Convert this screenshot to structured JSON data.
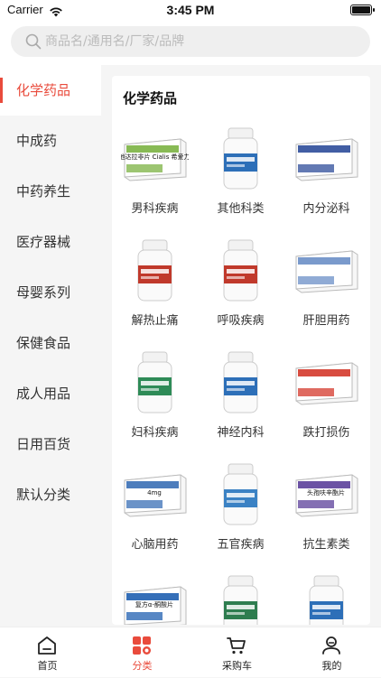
{
  "status": {
    "carrier": "Carrier",
    "time": "3:45 PM"
  },
  "search": {
    "placeholder": "商品名/通用名/厂家/品牌"
  },
  "sidebar": {
    "items": [
      {
        "label": "化学药品",
        "active": true
      },
      {
        "label": "中成药"
      },
      {
        "label": "中药养生"
      },
      {
        "label": "医疗器械"
      },
      {
        "label": "母婴系列"
      },
      {
        "label": "保健食品"
      },
      {
        "label": "成人用品"
      },
      {
        "label": "日用百货"
      },
      {
        "label": "默认分类"
      }
    ]
  },
  "section_title": "化学药品",
  "products": [
    {
      "label": "男科疾病",
      "pack_text": "他达拉非片 Cialis 希爱力",
      "color": "#7bb242"
    },
    {
      "label": "其他科类",
      "pack_text": "",
      "color": "#2d6fb8"
    },
    {
      "label": "内分泌科",
      "pack_text": "",
      "color": "#2d4c9a"
    },
    {
      "label": "解热止痛",
      "pack_text": "",
      "color": "#c0392b"
    },
    {
      "label": "呼吸疾病",
      "pack_text": "",
      "color": "#c0392b"
    },
    {
      "label": "肝胆用药",
      "pack_text": "",
      "color": "#6b8fc7"
    },
    {
      "label": "妇科疾病",
      "pack_text": "",
      "color": "#2e8b57"
    },
    {
      "label": "神经内科",
      "pack_text": "",
      "color": "#2d6fb8"
    },
    {
      "label": "跌打损伤",
      "pack_text": "",
      "color": "#d4382b"
    },
    {
      "label": "心脑用药",
      "pack_text": "4mg",
      "color": "#3a6fb5"
    },
    {
      "label": "五官疾病",
      "pack_text": "",
      "color": "#3b82c4"
    },
    {
      "label": "抗生素类",
      "pack_text": "头孢呋辛酯片",
      "color": "#5b3f9a"
    },
    {
      "label": "",
      "pack_text": "复方α-酮酸片",
      "color": "#1f5fb0"
    },
    {
      "label": "",
      "pack_text": "",
      "color": "#2e7d4f"
    },
    {
      "label": "",
      "pack_text": "",
      "color": "#2d6fb8"
    }
  ],
  "tabbar": {
    "items": [
      {
        "label": "首页",
        "icon": "home-icon"
      },
      {
        "label": "分类",
        "icon": "category-icon",
        "active": true
      },
      {
        "label": "采购车",
        "icon": "cart-icon"
      },
      {
        "label": "我的",
        "icon": "profile-icon"
      }
    ]
  },
  "colors": {
    "accent": "#e94b3c"
  }
}
